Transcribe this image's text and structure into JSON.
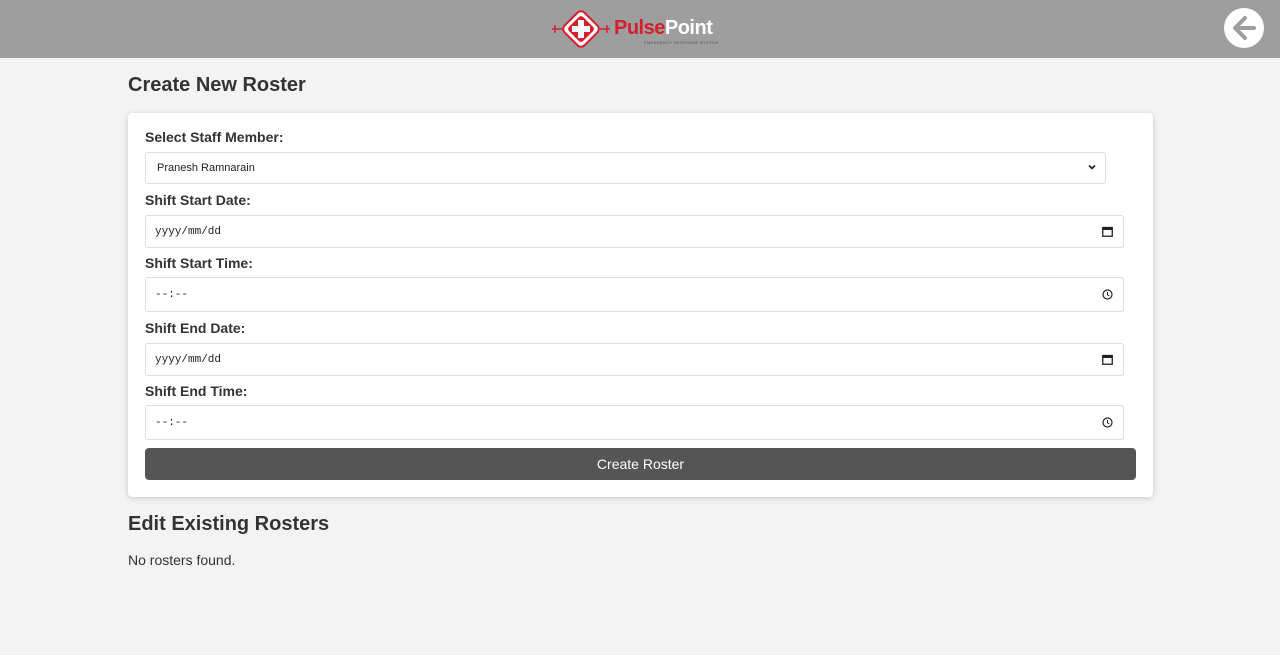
{
  "header": {
    "logo_part1": "Pulse",
    "logo_part2": "Point",
    "logo_tagline": "EMERGENCY RESPONSE SYSTEM",
    "back_icon": "arrow-left-icon",
    "bar_color": "#9e9e9e",
    "brand_red": "#d4202c"
  },
  "create": {
    "title": "Create New Roster",
    "staff_label": "Select Staff Member:",
    "staff_value": "Pranesh Ramnarain",
    "start_date_label": "Shift Start Date:",
    "start_date_placeholder": "yyyy/mm/dd",
    "start_time_label": "Shift Start Time:",
    "start_time_placeholder": "--:--",
    "end_date_label": "Shift End Date:",
    "end_date_placeholder": "yyyy/mm/dd",
    "end_time_label": "Shift End Time:",
    "end_time_placeholder": "--:--",
    "submit_label": "Create Roster",
    "button_color": "#555555"
  },
  "edit": {
    "title": "Edit Existing Rosters",
    "empty_message": "No rosters found."
  }
}
